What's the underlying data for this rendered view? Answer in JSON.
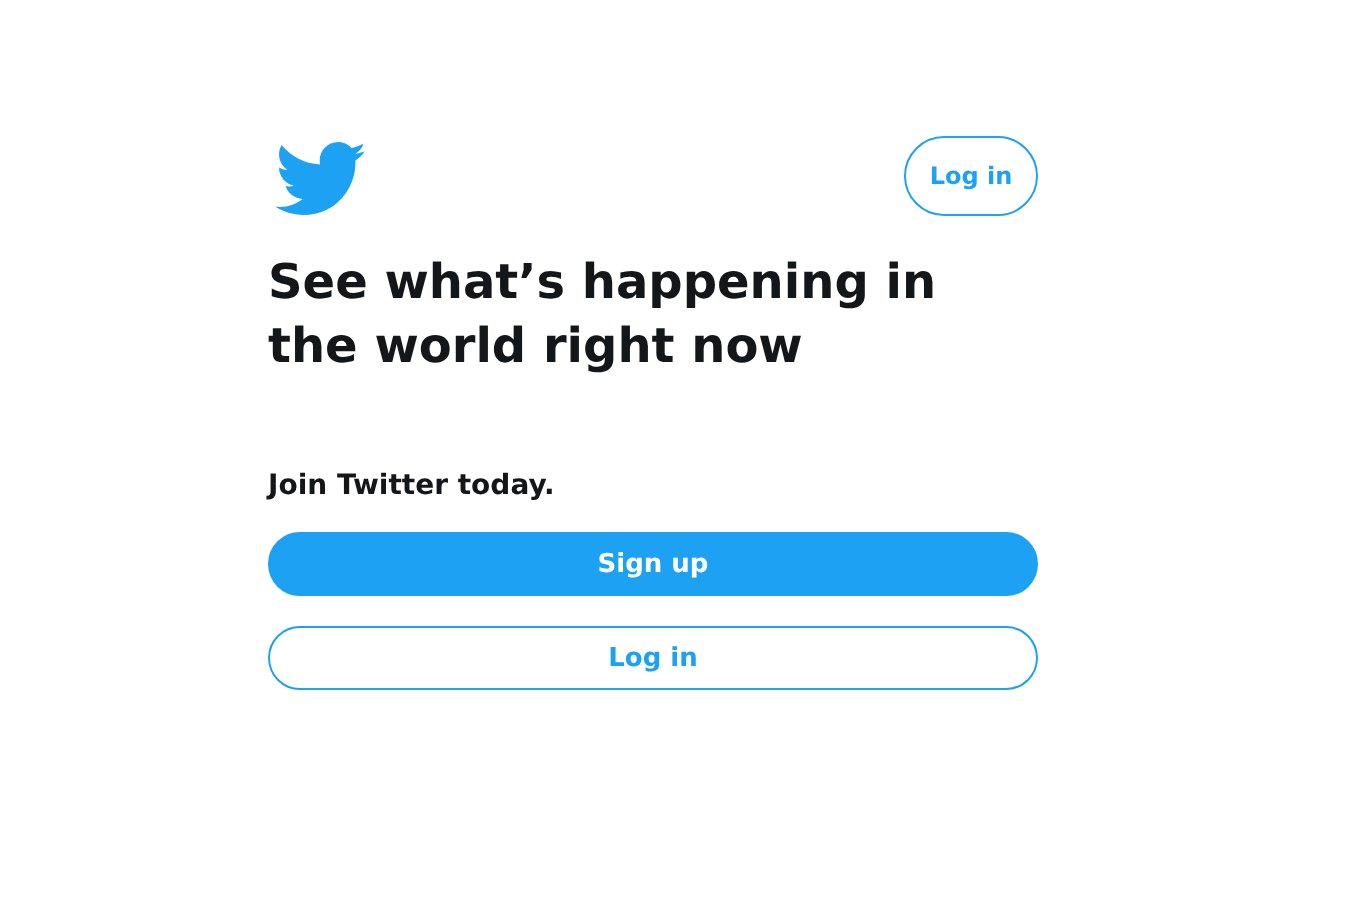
{
  "header": {
    "login_button": "Log in"
  },
  "headline": "See what’s happening in the world right now",
  "join_text": "Join Twitter today.",
  "buttons": [
    {
      "label": "Sign up",
      "kind": "primary"
    },
    {
      "label": "Log in",
      "kind": "outline"
    }
  ]
}
